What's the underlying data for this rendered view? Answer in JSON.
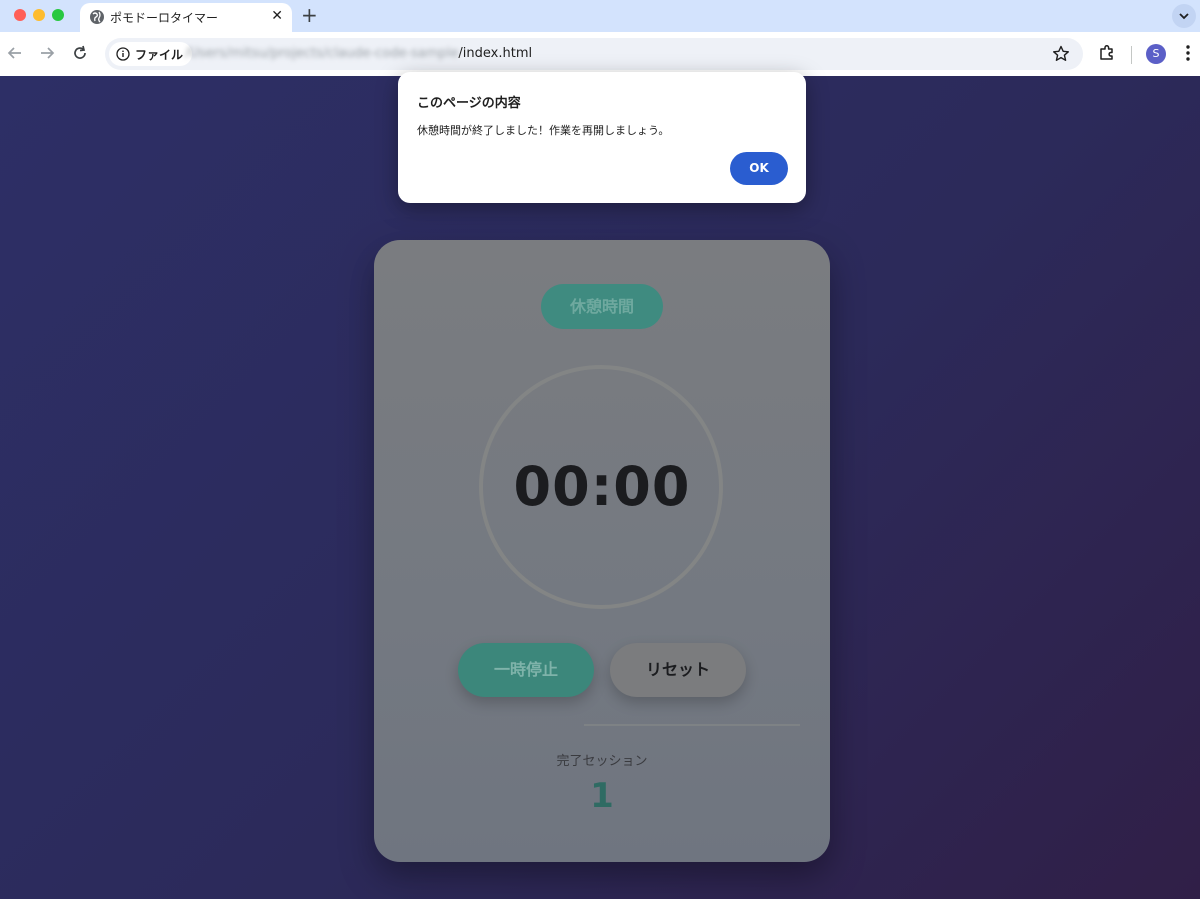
{
  "browser": {
    "tab": {
      "title": "ポモドーロタイマー",
      "close": "✕"
    },
    "new_tab": "+",
    "omnibox": {
      "chip_label": "ファイル",
      "url_blurred": "/Users/mitsu/projects/claude-code-sample",
      "url_path": "/index.html"
    },
    "profile_initial": "S"
  },
  "timer": {
    "mode_label": "休憩時間",
    "time": "00:00",
    "pause_label": "一時停止",
    "reset_label": "リセット",
    "sessions_label": "完了セッション",
    "sessions_count": "1"
  },
  "dialog": {
    "title": "このページの内容",
    "message": "休憩時間が終了しました！作業を再開しましょう。",
    "ok_label": "OK"
  },
  "colors": {
    "accent": "#3f8b80",
    "dialog_button": "#2a5dd0"
  }
}
